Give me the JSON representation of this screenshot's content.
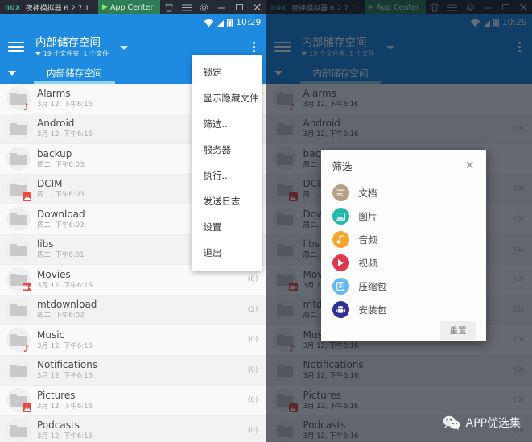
{
  "emulator": {
    "logo": "nox",
    "title": "夜神模拟器 6.2.7.1",
    "app_center": "App Center",
    "icons": [
      "shirt-icon",
      "menu-icon",
      "gear-icon",
      "minimize-icon",
      "maximize-icon",
      "close-icon"
    ]
  },
  "status_bar": {
    "time": "10:29",
    "icons": [
      "wifi-icon",
      "signal-icon",
      "battery-icon"
    ]
  },
  "appbar": {
    "title": "内部储存空间",
    "subtitle": "19 个文件夹, 1 个文件",
    "menu_icon": "hamburger-icon",
    "overflow_icon": "kebab-icon",
    "dropdown_icon": "caret-down-icon"
  },
  "tabstrip": {
    "expand_icon": "chevron-down-icon",
    "tab_label": "内部储存空间"
  },
  "files": [
    {
      "name": "Alarms",
      "date": "3月 12, 下午6:16",
      "count": "",
      "badge": "music"
    },
    {
      "name": "Android",
      "date": "3月 12, 下午6:16",
      "count": "(0)",
      "badge": ""
    },
    {
      "name": "backup",
      "date": "周二, 下午6:03",
      "count": "",
      "badge": ""
    },
    {
      "name": "DCIM",
      "date": "周二, 下午6:03",
      "count": "(0)",
      "badge": "image"
    },
    {
      "name": "Download",
      "date": "周二, 下午6:03",
      "count": "(0)",
      "badge": ""
    },
    {
      "name": "libs",
      "date": "周二, 下午6:01",
      "count": "(1)",
      "badge": ""
    },
    {
      "name": "Movies",
      "date": "3月 12, 下午6:16",
      "count": "(0)",
      "badge": "video"
    },
    {
      "name": "mtdownload",
      "date": "周二, 下午6:03",
      "count": "(2)",
      "badge": ""
    },
    {
      "name": "Music",
      "date": "3月 12, 下午6:16",
      "count": "(0)",
      "badge": "music"
    },
    {
      "name": "Notifications",
      "date": "3月 12, 下午6:16",
      "count": "(0)",
      "badge": ""
    },
    {
      "name": "Pictures",
      "date": "3月 12, 下午6:16",
      "count": "(0)",
      "badge": "image"
    },
    {
      "name": "Podcasts",
      "date": "3月 12, 下午6:16",
      "count": "(0)",
      "badge": ""
    }
  ],
  "overflow_menu": {
    "items": [
      "锁定",
      "显示隐藏文件",
      "筛选...",
      "服务器",
      "执行...",
      "发送日志",
      "设置",
      "退出"
    ]
  },
  "filter_dialog": {
    "title": "筛选",
    "close_icon": "close-icon",
    "reset_label": "重置",
    "items": [
      {
        "label": "文档",
        "icon": "document-icon",
        "color": "#b3a082"
      },
      {
        "label": "图片",
        "icon": "image-icon",
        "color": "#1fb9ad"
      },
      {
        "label": "音频",
        "icon": "audio-icon",
        "color": "#f5a62b"
      },
      {
        "label": "视频",
        "icon": "video-icon",
        "color": "#e1394b"
      },
      {
        "label": "压缩包",
        "icon": "archive-icon",
        "color": "#61b9ef"
      },
      {
        "label": "安装包",
        "icon": "apk-icon",
        "color": "#2f2f96"
      }
    ]
  },
  "watermark": {
    "icon": "wechat-icon",
    "text": "APP优选集"
  },
  "colors": {
    "accent": "#1e8ae0",
    "tab_indicator": "#8fd4f7",
    "emulator_bar": "#262b33",
    "app_center": "#2f7d55"
  }
}
